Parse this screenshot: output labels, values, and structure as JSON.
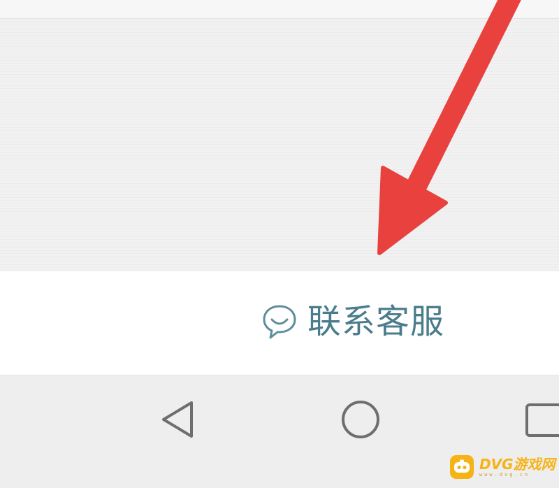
{
  "service_bar": {
    "contact_label": "联系客服",
    "contact_icon": "chat-bubble-icon",
    "accent_color": "#4a7c8c"
  },
  "nav_bar": {
    "back_icon": "back-triangle-icon",
    "home_icon": "home-circle-icon",
    "recent_icon": "recent-apps-square-icon"
  },
  "annotation": {
    "arrow_color": "#e8413e",
    "arrow_icon": "pointer-arrow-icon"
  },
  "watermark": {
    "text": "DVG游戏网",
    "subtext": "www.dvg.cn",
    "logo_icon": "gamepad-logo-icon",
    "color": "#f5b316"
  }
}
